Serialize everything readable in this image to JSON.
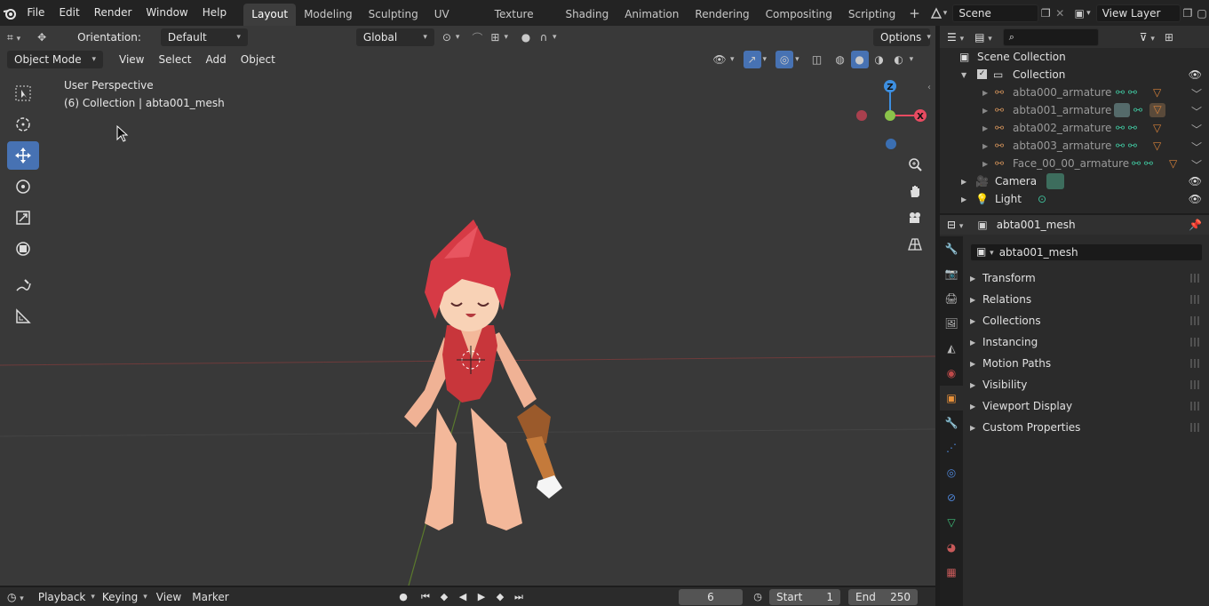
{
  "topbar": {
    "menus": [
      "File",
      "Edit",
      "Render",
      "Window",
      "Help"
    ],
    "workspaces": [
      "Layout",
      "Modeling",
      "Sculpting",
      "UV Editing",
      "Texture Paint",
      "Shading",
      "Animation",
      "Rendering",
      "Compositing",
      "Scripting"
    ],
    "active_workspace": "Layout",
    "scene": "Scene",
    "view_layer": "View Layer"
  },
  "viewport": {
    "orientation_label": "Orientation:",
    "orientation_value": "Default",
    "transform_orientation": "Global",
    "options_label": "Options",
    "mode": "Object Mode",
    "menus": [
      "View",
      "Select",
      "Add",
      "Object"
    ],
    "perspective_label": "User Perspective",
    "collection_label": "(6) Collection | abta001_mesh",
    "gizmo_axes": {
      "z": "Z",
      "x": "X"
    }
  },
  "timeline": {
    "menus": [
      "Playback",
      "Keying",
      "View",
      "Marker"
    ],
    "current_frame": "6",
    "start_label": "Start",
    "start_value": "1",
    "end_label": "End",
    "end_value": "250"
  },
  "outliner": {
    "scene_collection": "Scene Collection",
    "collection": "Collection",
    "items": [
      {
        "label": "abta000_armature"
      },
      {
        "label": "abta001_armature"
      },
      {
        "label": "abta002_armature"
      },
      {
        "label": "abta003_armature"
      },
      {
        "label": "Face_00_00_armature"
      }
    ],
    "camera": "Camera",
    "light": "Light"
  },
  "properties": {
    "object_name": "abta001_mesh",
    "name_field": "abta001_mesh",
    "panels": [
      "Transform",
      "Relations",
      "Collections",
      "Instancing",
      "Motion Paths",
      "Visibility",
      "Viewport Display",
      "Custom Properties"
    ]
  },
  "colors": {
    "accent": "#4772b3",
    "axis_x": "#e84b61",
    "axis_y": "#8bc34a",
    "axis_z": "#3d8fe0"
  }
}
